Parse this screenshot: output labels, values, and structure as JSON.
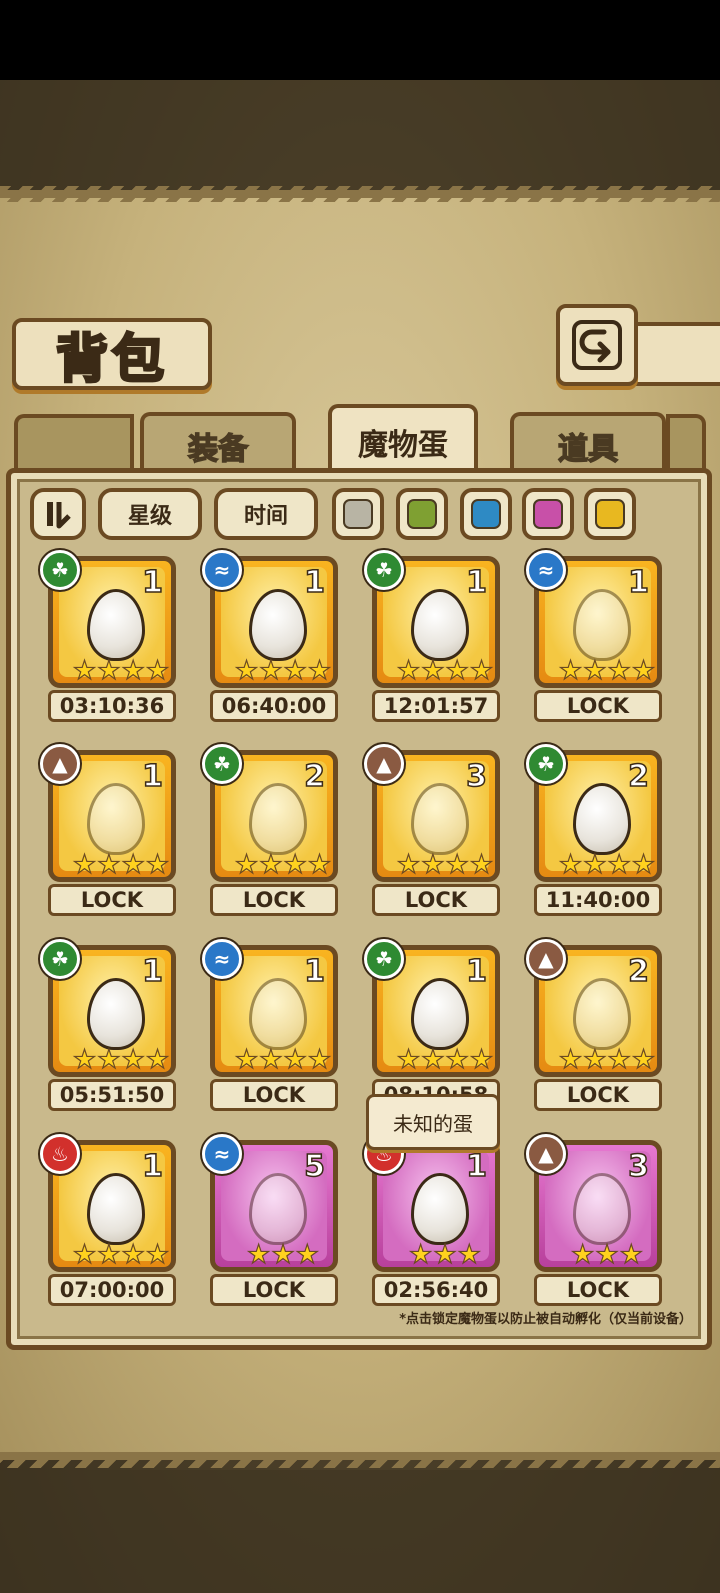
{
  "header": {
    "title": "背包"
  },
  "tabs": [
    {
      "label": "装备",
      "active": false
    },
    {
      "label": "魔物蛋",
      "active": true
    },
    {
      "label": "道具",
      "active": false
    }
  ],
  "filters": {
    "sort_icon": "sort-toggle-icon",
    "star_label": "星级",
    "time_label": "时间",
    "colors": [
      "#b8b4a4",
      "#7fa032",
      "#2e8ac4",
      "#c850a8",
      "#e8b820"
    ]
  },
  "eggs": [
    {
      "element": "leaf",
      "count": "1",
      "frame": "gold",
      "stars": 4,
      "status": "03:10:36"
    },
    {
      "element": "water",
      "count": "1",
      "frame": "gold",
      "stars": 4,
      "status": "06:40:00"
    },
    {
      "element": "leaf",
      "count": "1",
      "frame": "gold",
      "stars": 4,
      "status": "12:01:57"
    },
    {
      "element": "water",
      "count": "1",
      "frame": "gold",
      "stars": 4,
      "status": "LOCK"
    },
    {
      "element": "earth",
      "count": "1",
      "frame": "gold",
      "stars": 4,
      "status": "LOCK"
    },
    {
      "element": "leaf",
      "count": "2",
      "frame": "gold",
      "stars": 4,
      "status": "LOCK"
    },
    {
      "element": "earth",
      "count": "3",
      "frame": "gold",
      "stars": 4,
      "status": "LOCK"
    },
    {
      "element": "leaf",
      "count": "2",
      "frame": "gold",
      "stars": 4,
      "status": "11:40:00"
    },
    {
      "element": "leaf",
      "count": "1",
      "frame": "gold",
      "stars": 4,
      "status": "05:51:50"
    },
    {
      "element": "water",
      "count": "1",
      "frame": "gold",
      "stars": 4,
      "status": "LOCK"
    },
    {
      "element": "leaf",
      "count": "1",
      "frame": "gold",
      "stars": 4,
      "status": "08:10:58"
    },
    {
      "element": "earth",
      "count": "2",
      "frame": "gold",
      "stars": 4,
      "status": "LOCK"
    },
    {
      "element": "fire",
      "count": "1",
      "frame": "gold",
      "stars": 4,
      "status": "07:00:00"
    },
    {
      "element": "water",
      "count": "5",
      "frame": "purple",
      "stars": 3,
      "status": "LOCK"
    },
    {
      "element": "fire",
      "count": "1",
      "frame": "purple",
      "stars": 3,
      "status": "02:56:40"
    },
    {
      "element": "earth",
      "count": "3",
      "frame": "purple",
      "stars": 3,
      "status": "LOCK"
    }
  ],
  "tooltip": {
    "text": "未知的蛋"
  },
  "footnote": "*点击锁定魔物蛋以防止被自动孵化（仅当前设备）"
}
